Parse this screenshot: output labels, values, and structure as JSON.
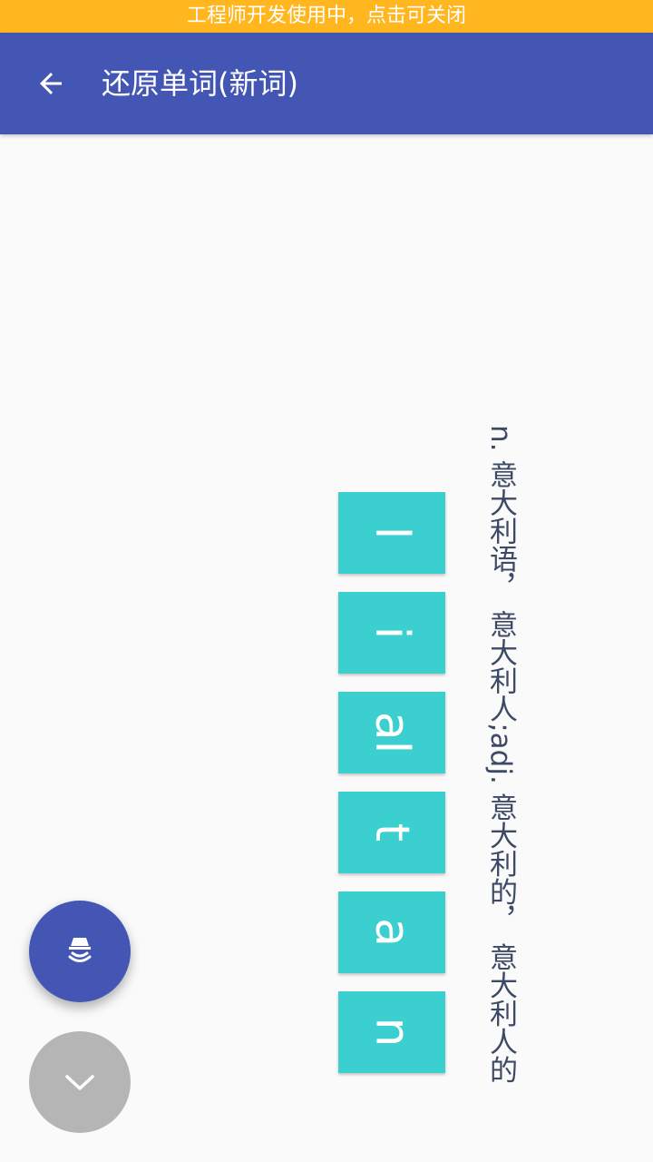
{
  "dev_banner": {
    "text": "工程师开发使用中，点击可关闭"
  },
  "toolbar": {
    "back_icon": "arrow-left-icon",
    "title": "还原单词(新词)"
  },
  "main": {
    "definition": "n. 意大利语， 意大利人;adj. 意大利的， 意大利人的",
    "tiles": [
      "l",
      "i",
      "al",
      "t",
      "a",
      "n"
    ]
  },
  "fabs": {
    "speak_icon": "speaker-sound-icon",
    "collapse_icon": "chevron-down-icon"
  },
  "colors": {
    "banner": "#ffb61f",
    "toolbar": "#4356b4",
    "tile": "#3ccfcf",
    "fab_primary": "#4356b4",
    "fab_secondary": "#b5b5b5"
  }
}
